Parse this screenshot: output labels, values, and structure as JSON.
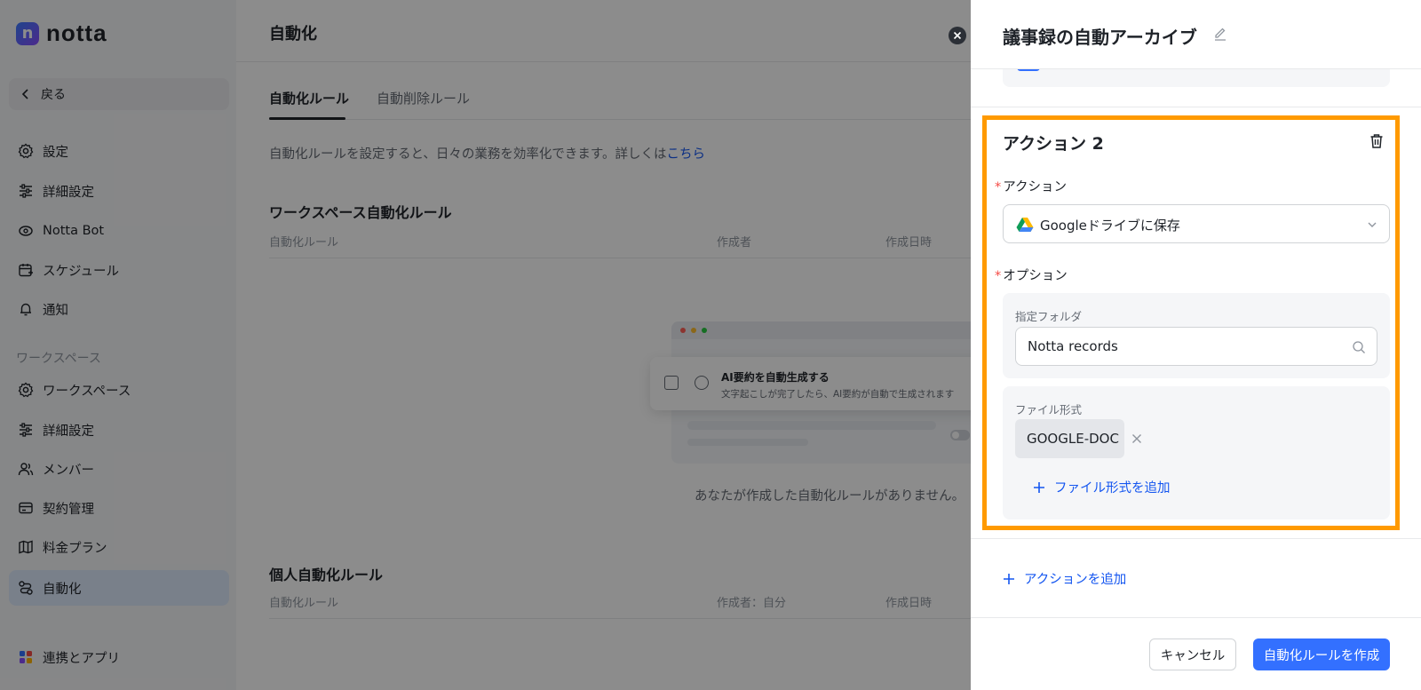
{
  "app": {
    "name": "notta",
    "logo_letter": "n"
  },
  "sidebar": {
    "back_label": "戻る",
    "items_top": [
      {
        "label": "設定",
        "icon": "gear-icon"
      },
      {
        "label": "詳細設定",
        "icon": "sliders-icon"
      },
      {
        "label": "Notta Bot",
        "icon": "bot-icon"
      },
      {
        "label": "スケジュール",
        "icon": "calendar-icon"
      },
      {
        "label": "通知",
        "icon": "bell-icon"
      }
    ],
    "workspace_section": "ワークスペース",
    "items_workspace": [
      {
        "label": "ワークスペース",
        "icon": "gear-icon"
      },
      {
        "label": "詳細設定",
        "icon": "sliders-icon"
      },
      {
        "label": "メンバー",
        "icon": "users-icon"
      },
      {
        "label": "契約管理",
        "icon": "card-icon"
      },
      {
        "label": "料金プラン",
        "icon": "map-icon"
      },
      {
        "label": "自動化",
        "icon": "automation-icon",
        "active": true
      }
    ],
    "integrations_label": "連携とアプリ"
  },
  "main": {
    "title": "自動化",
    "tabs": [
      {
        "label": "自動化ルール",
        "active": true
      },
      {
        "label": "自動削除ルール",
        "active": false
      }
    ],
    "description": "自動化ルールを設定すると、日々の業務を効率化できます。詳しくは",
    "description_link": "こちら",
    "workspace_rules": {
      "title": "ワークスペース自動化ルール",
      "columns": [
        "自動化ルール",
        "作成者",
        "作成日時"
      ]
    },
    "illustration": {
      "card_title": "AI要約を自動生成する",
      "card_subtitle": "文字起こしが完了したら、AI要約が自動で生成されます"
    },
    "empty_text": "あなたが作成した自動化ルールがありません。",
    "personal_rules": {
      "title": "個人自動化ルール",
      "columns": [
        "自動化ルール",
        "作成者：自分",
        "作成日時"
      ]
    }
  },
  "drawer": {
    "title": "議事録の自動アーカイブ",
    "action_title": "アクション 2",
    "action_label": "アクション",
    "action_value": "Googleドライブに保存",
    "option_label": "オプション",
    "folder_label": "指定フォルダ",
    "folder_value": "Notta records",
    "format_label": "ファイル形式",
    "format_chip": "GOOGLE-DOC",
    "add_format_label": "ファイル形式を追加",
    "add_action_label": "アクションを追加",
    "cancel_label": "キャンセル",
    "create_label": "自動化ルールを作成",
    "required_mark": "*"
  },
  "colors": {
    "accent": "#3370ff",
    "highlight": "#ff9a00",
    "link": "#1456f0"
  }
}
